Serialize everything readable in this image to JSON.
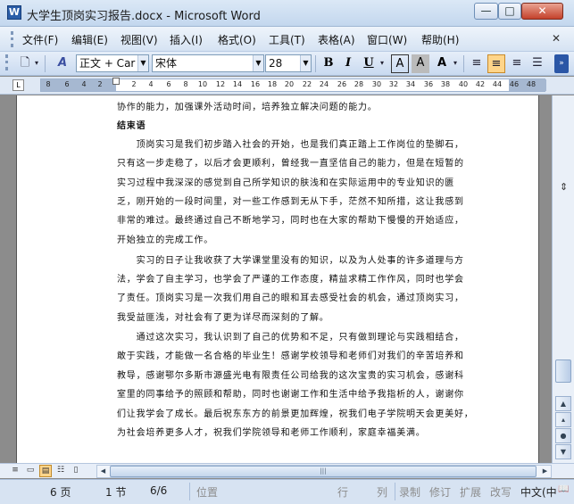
{
  "window": {
    "title": "大学生顶岗实习报告.docx - Microsoft Word",
    "minimize": "—",
    "maximize": "□",
    "close": "✕"
  },
  "menu": {
    "items": [
      "文件(F)",
      "编辑(E)",
      "视图(V)",
      "插入(I)",
      "格式(O)",
      "工具(T)",
      "表格(A)",
      "窗口(W)",
      "帮助(H)"
    ],
    "close_doc": "✕"
  },
  "toolbar": {
    "style": "正文 + Car",
    "font": "宋体",
    "size": "28",
    "bold": "B",
    "italic": "I",
    "underline": "U",
    "char_border": "A",
    "char_shade": "A",
    "highlight": "A"
  },
  "ruler": {
    "corner": "L",
    "numbers": [
      "8",
      "6",
      "4",
      "2",
      "2",
      "4",
      "6",
      "8",
      "10",
      "12",
      "14",
      "16",
      "18",
      "20",
      "22",
      "24",
      "26",
      "28",
      "30",
      "32",
      "34",
      "36",
      "38",
      "40",
      "42",
      "44",
      "46",
      "48"
    ]
  },
  "document": {
    "lines": [
      {
        "text": "协作的能力，加强课外活动时间，培养独立解决问题的能力。",
        "bold": false
      },
      {
        "text": "结束语",
        "bold": true
      },
      {
        "text": "　　顶岗实习是我们初步踏入社会的开始，也是我们真正踏上工作岗位的垫脚石，",
        "bold": false
      },
      {
        "text": "只有这一步走稳了，以后才会更顺利，曾经我一直坚信自己的能力，但是在短暂的",
        "bold": false
      },
      {
        "text": "实习过程中我深深的感觉到自己所学知识的肤浅和在实际运用中的专业知识的匮",
        "bold": false
      },
      {
        "text": "乏，刚开始的一段时间里，对一些工作感到无从下手，茫然不知所措，这让我感到",
        "bold": false
      },
      {
        "text": "非常的难过。最终通过自己不断地学习，同时也在大家的帮助下慢慢的开始适应，",
        "bold": false
      },
      {
        "text": "开始独立的完成工作。",
        "bold": false
      },
      {
        "text": "　　实习的日子让我收获了大学课堂里没有的知识，以及为人处事的许多道理与方",
        "bold": false
      },
      {
        "text": "法，学会了自主学习，也学会了严谨的工作态度，精益求精工作作风，同时也学会",
        "bold": false
      },
      {
        "text": "了责任。顶岗实习是一次我们用自己的眼和耳去感受社会的机会，通过顶岗实习，",
        "bold": false
      },
      {
        "text": "我受益匪浅，对社会有了更为详尽而深刻的了解。",
        "bold": false
      },
      {
        "text": "　　通过这次实习，我认识到了自己的优势和不足，只有做到理论与实践相结合，",
        "bold": false
      },
      {
        "text": "敢于实践，才能做一名合格的毕业生！感谢学校领导和老师们对我们的辛苦培养和",
        "bold": false
      },
      {
        "text": "教导，感谢鄂尔多斯市源盛光电有限责任公司给我的这次宝贵的实习机会，感谢科",
        "bold": false
      },
      {
        "text": "室里的同事给予的照顾和帮助，同时也谢谢工作和生活中给予我指析的人，谢谢你",
        "bold": false
      },
      {
        "text": "们让我学会了成长。最后祝东东方的前景更加辉煌，祝我们电子学院明天会更美好，",
        "bold": false
      },
      {
        "text": "为社会培养更多人才，祝我们学院领导和老师工作顺利，家庭幸福美满。",
        "bold": false
      }
    ]
  },
  "status": {
    "page": "6 页",
    "section": "1 节",
    "page_of": "6/6",
    "position": "位置",
    "line": "行",
    "column": "列",
    "rec": "录制",
    "trk": "修订",
    "ext": "扩展",
    "ovr": "改写",
    "lang": "中文(中"
  }
}
